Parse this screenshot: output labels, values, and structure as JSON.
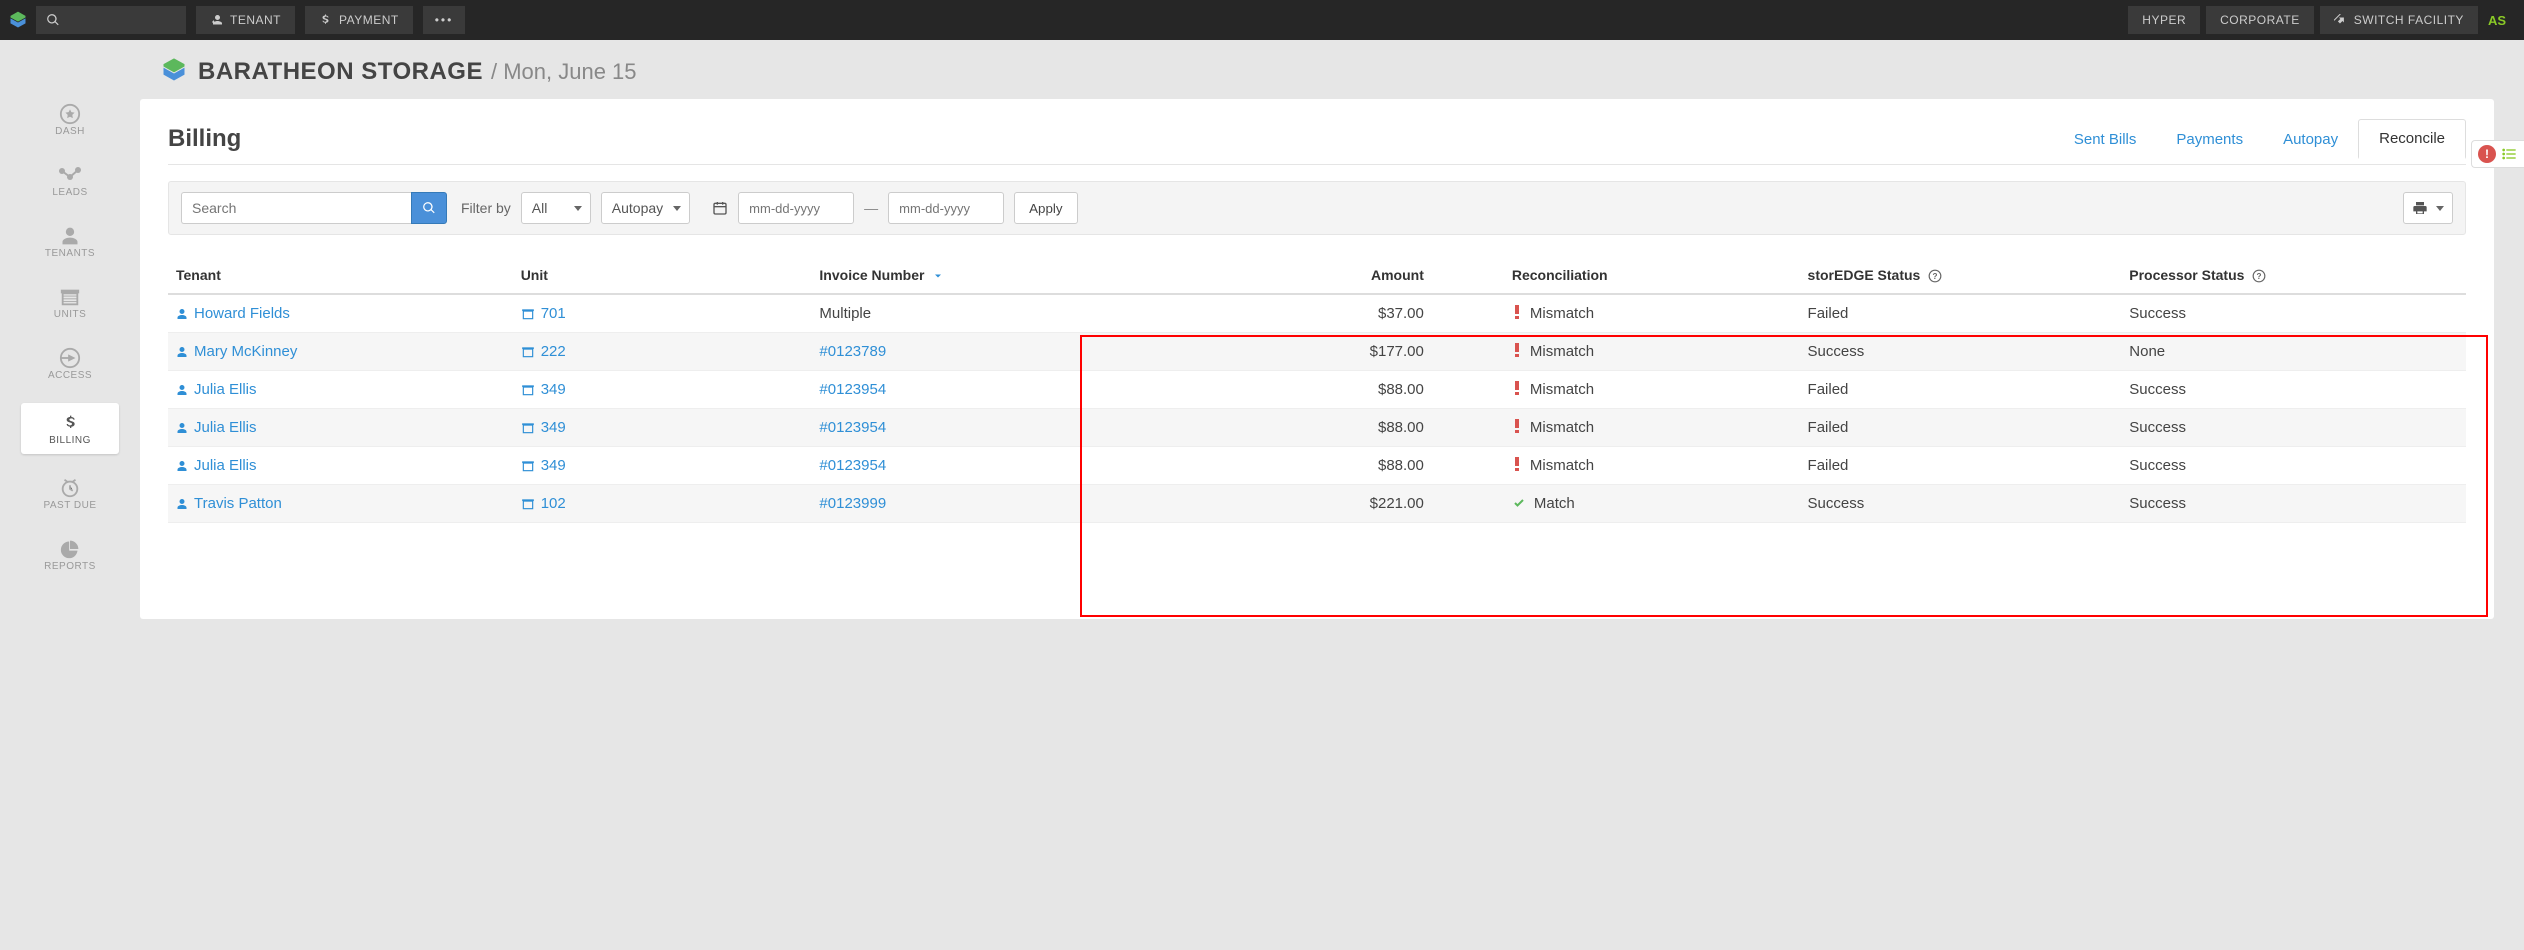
{
  "topbar": {
    "tenant_btn": "TENANT",
    "payment_btn": "PAYMENT",
    "hyper": "HYPER",
    "corporate": "CORPORATE",
    "switch_facility": "SWITCH FACILITY",
    "user_initials": "AS"
  },
  "header": {
    "facility": "BARATHEON STORAGE",
    "date_prefix": "/ ",
    "date": "Mon, June 15"
  },
  "sidebar": {
    "items": [
      {
        "label": "DASH"
      },
      {
        "label": "LEADS"
      },
      {
        "label": "TENANTS"
      },
      {
        "label": "UNITS"
      },
      {
        "label": "ACCESS"
      },
      {
        "label": "BILLING"
      },
      {
        "label": "PAST DUE"
      },
      {
        "label": "REPORTS"
      }
    ]
  },
  "panel": {
    "title": "Billing",
    "tabs": {
      "sent_bills": "Sent Bills",
      "payments": "Payments",
      "autopay": "Autopay",
      "reconcile": "Reconcile"
    }
  },
  "filter": {
    "search_placeholder": "Search",
    "filter_by_label": "Filter by",
    "filter_all": "All",
    "autopay": "Autopay",
    "date_placeholder": "mm-dd-yyyy",
    "apply": "Apply"
  },
  "table": {
    "cols": {
      "tenant": "Tenant",
      "unit": "Unit",
      "invoice": "Invoice Number",
      "amount": "Amount",
      "reconciliation": "Reconciliation",
      "storedge": "storEDGE Status",
      "processor": "Processor Status"
    },
    "rows": [
      {
        "tenant": "Howard Fields",
        "unit": "701",
        "invoice": "Multiple",
        "invoice_link": false,
        "amount": "$37.00",
        "recon": "Mismatch",
        "recon_ok": false,
        "storedge": "Failed",
        "processor": "Success"
      },
      {
        "tenant": "Mary McKinney",
        "unit": "222",
        "invoice": "#0123789",
        "invoice_link": true,
        "amount": "$177.00",
        "recon": "Mismatch",
        "recon_ok": false,
        "storedge": "Success",
        "processor": "None"
      },
      {
        "tenant": "Julia Ellis",
        "unit": "349",
        "invoice": "#0123954",
        "invoice_link": true,
        "amount": "$88.00",
        "recon": "Mismatch",
        "recon_ok": false,
        "storedge": "Failed",
        "processor": "Success"
      },
      {
        "tenant": "Julia Ellis",
        "unit": "349",
        "invoice": "#0123954",
        "invoice_link": true,
        "amount": "$88.00",
        "recon": "Mismatch",
        "recon_ok": false,
        "storedge": "Failed",
        "processor": "Success"
      },
      {
        "tenant": "Julia Ellis",
        "unit": "349",
        "invoice": "#0123954",
        "invoice_link": true,
        "amount": "$88.00",
        "recon": "Mismatch",
        "recon_ok": false,
        "storedge": "Failed",
        "processor": "Success"
      },
      {
        "tenant": "Travis Patton",
        "unit": "102",
        "invoice": "#0123999",
        "invoice_link": true,
        "amount": "$221.00",
        "recon": "Match",
        "recon_ok": true,
        "storedge": "Success",
        "processor": "Success"
      }
    ]
  }
}
